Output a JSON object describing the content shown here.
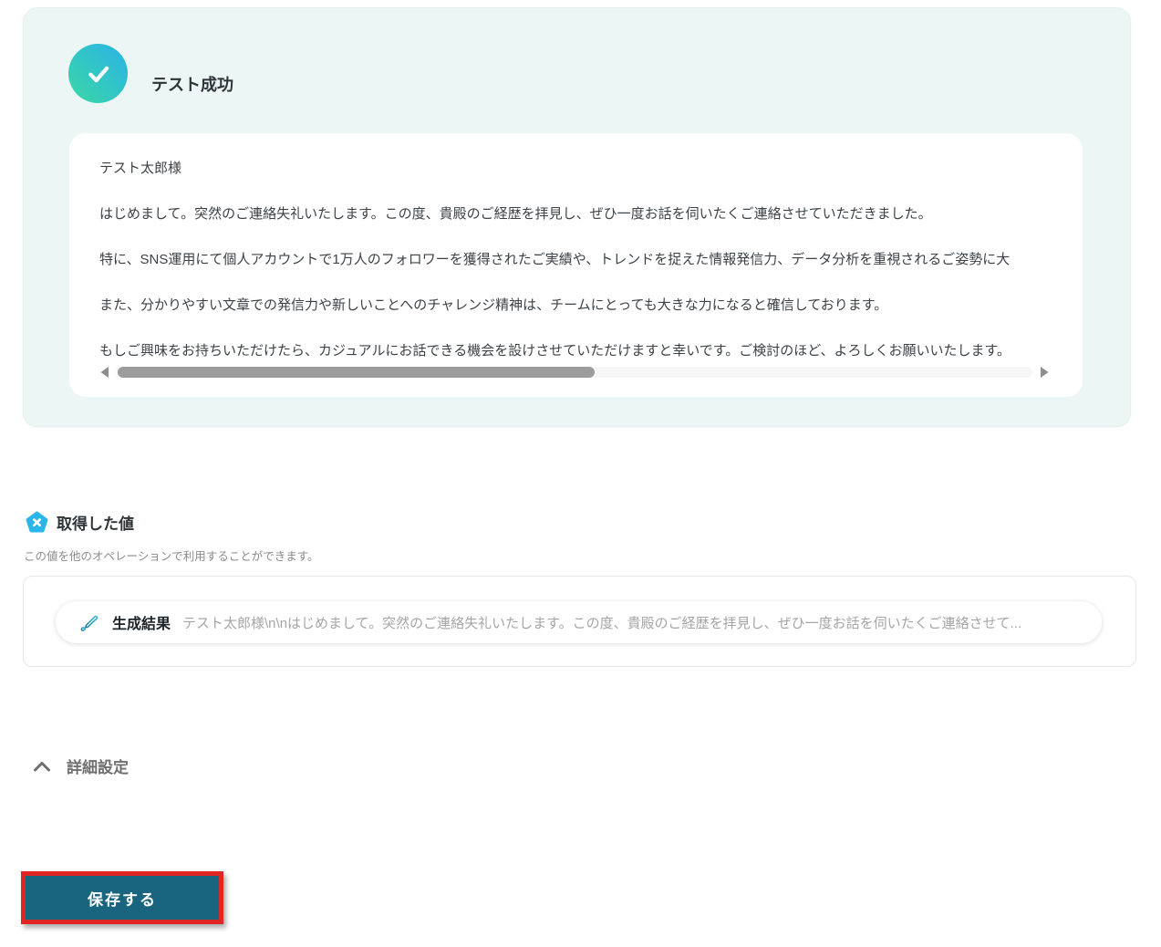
{
  "success_panel": {
    "title": "テスト成功",
    "paragraphs": [
      "テスト太郎様",
      "はじめまして。突然のご連絡失礼いたします。この度、貴殿のご経歴を拝見し、ぜひ一度お話を伺いたくご連絡させていただきました。",
      "特に、SNS運用にて個人アカウントで1万人のフォロワーを獲得されたご実績や、トレンドを捉えた情報発信力、データ分析を重視されるご姿勢に大",
      "また、分かりやすい文章での発信力や新しいことへのチャレンジ精神は、チームにとっても大きな力になると確信しております。",
      "もしご興味をお持ちいただけたら、カジュアルにお話できる機会を設けさせていただけますと幸いです。ご検討のほど、よろしくお願いいたします。"
    ]
  },
  "retrieved_values": {
    "title": "取得した値",
    "description": "この値を他のオペレーションで利用することができます。",
    "result": {
      "label": "生成結果",
      "preview": "テスト太郎様\\n\\nはじめまして。突然のご連絡失礼いたします。この度、貴殿のご経歴を拝見し、ぜひ一度お話を伺いたくご連絡させて..."
    }
  },
  "advanced_settings": {
    "label": "詳細設定"
  },
  "save": {
    "label": "保存する"
  },
  "icons": {
    "success": "check-icon",
    "variable": "pentagon-x-icon",
    "result": "edit-pencil-icon",
    "collapse": "chevron-up-icon",
    "scroll_left": "triangle-left-icon",
    "scroll_right": "triangle-right-icon"
  },
  "colors": {
    "panel_mint": "#ecf7f5",
    "check_gradient_start": "#3bd8a4",
    "check_gradient_end": "#29b3e8",
    "pentagon_blue": "#2ab6e9",
    "save_teal": "#19647e",
    "annotation_red": "#e02525",
    "scroll_thumb_gray": "#9c9c9c"
  }
}
